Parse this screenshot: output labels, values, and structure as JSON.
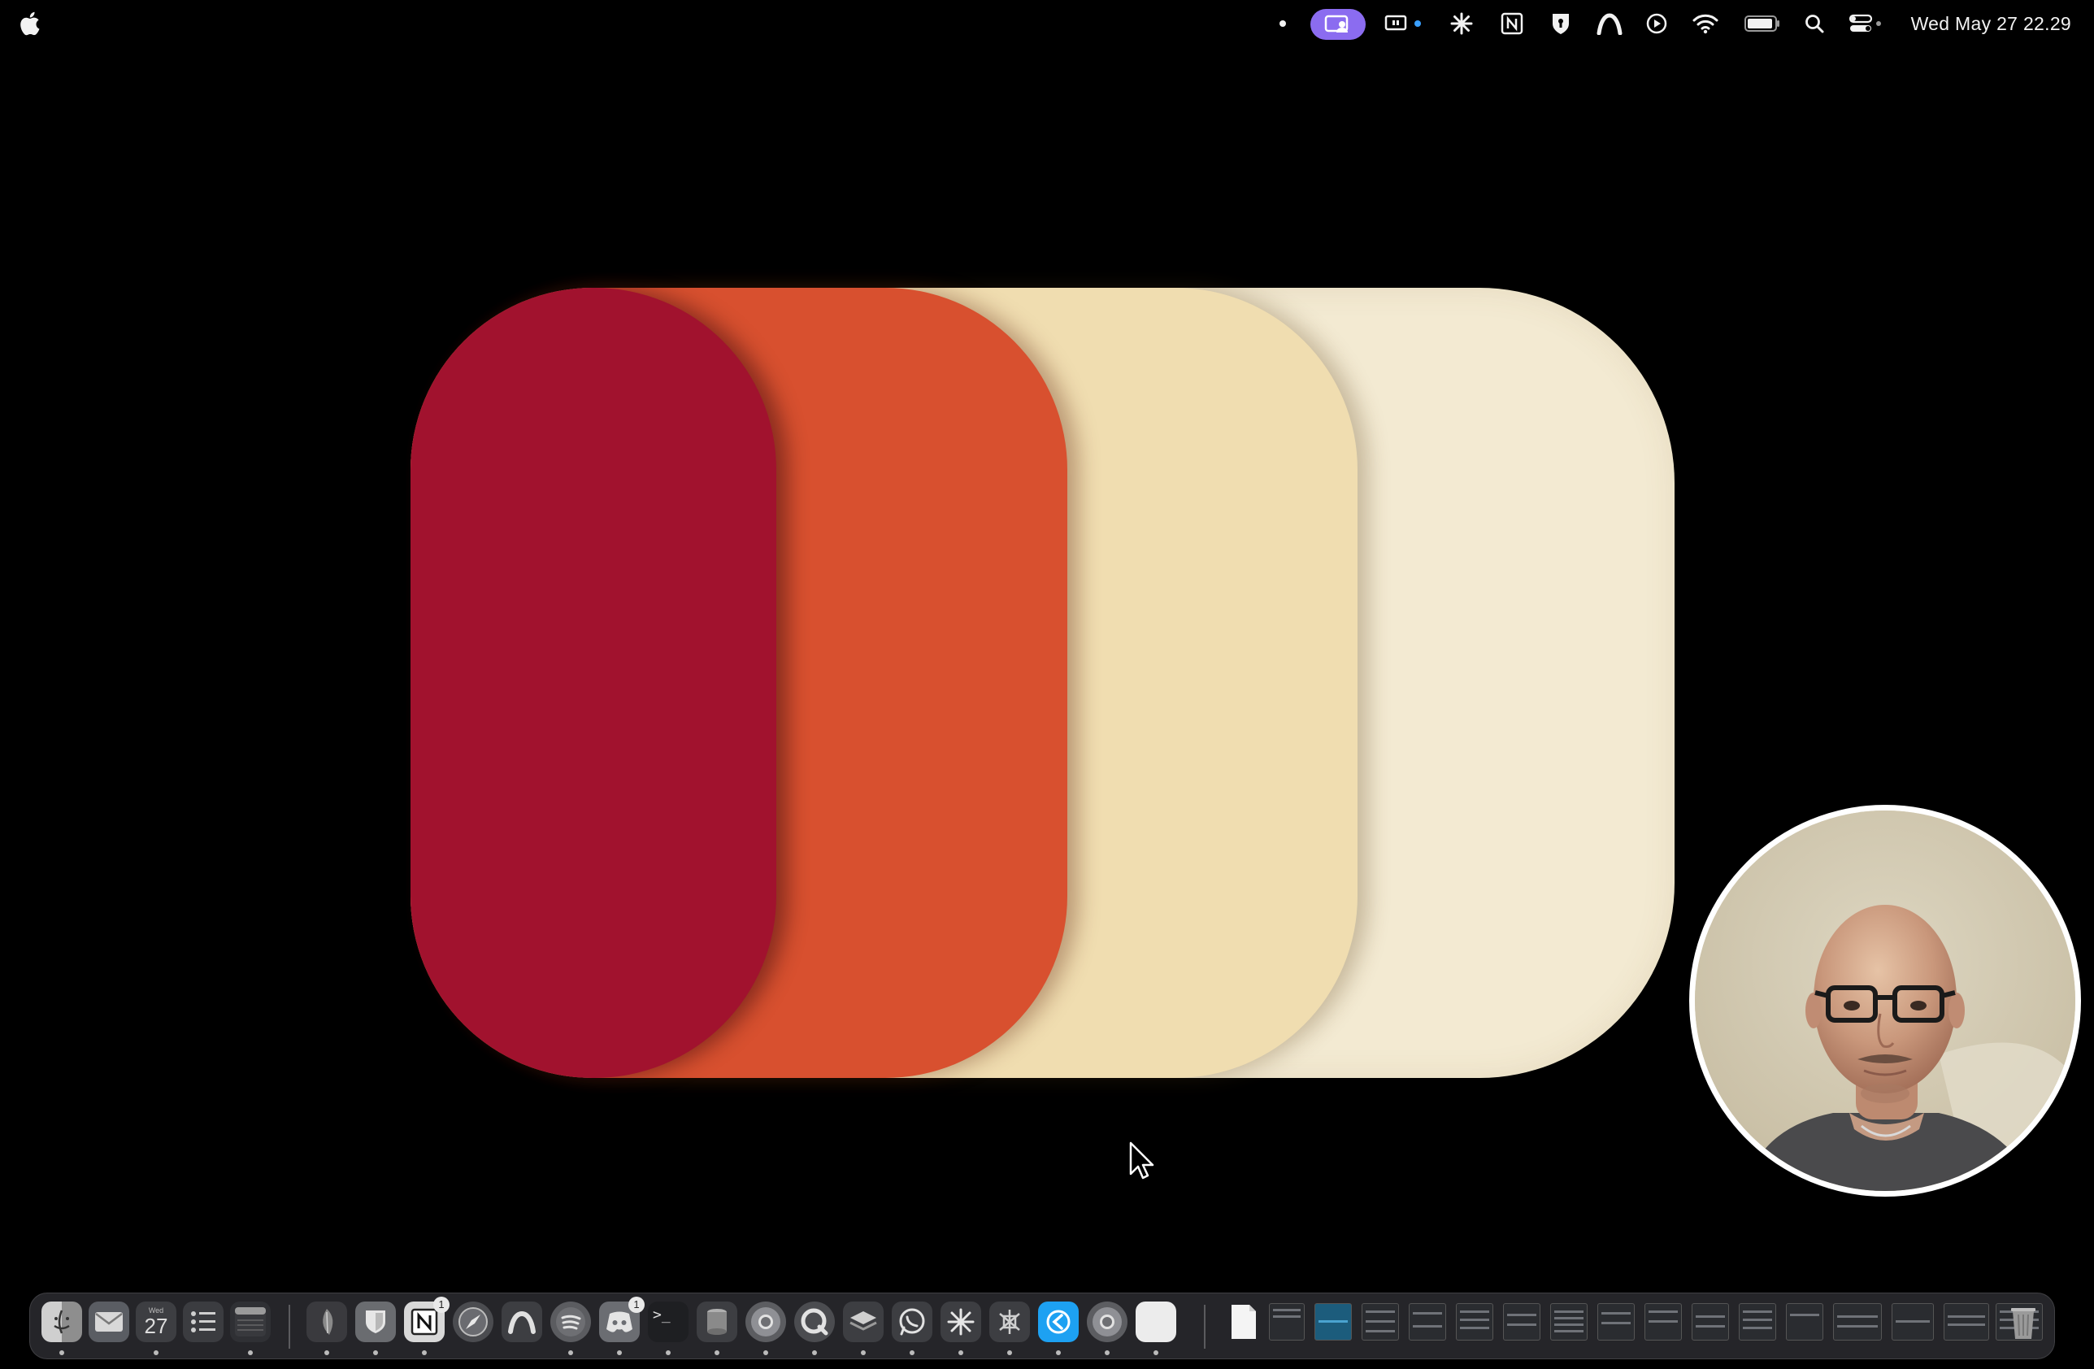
{
  "menubar": {
    "clock": "Wed May 27  22.29",
    "accent_color": "#8b6cf0",
    "status_icons": [
      "dot-icon",
      "screen-share-icon",
      "display-icon",
      "sparkle-icon",
      "notion-icon",
      "keyhole-icon",
      "arc-icon",
      "play-icon",
      "wifi-icon",
      "battery-icon",
      "search-icon",
      "control-center-icon"
    ]
  },
  "wallpaper": {
    "colors": [
      "#a1122e",
      "#d8502f",
      "#f0ddb0",
      "#f3ead2"
    ]
  },
  "dock": {
    "calendar_day_label": "Wed",
    "calendar_date": "27",
    "notion_badge": "1",
    "discord_badge": "1",
    "terminal_prompt": ">_",
    "apps": [
      "finder",
      "mail",
      "calendar",
      "reminders",
      "notes",
      "pdf",
      "bitwarden",
      "notion",
      "compass",
      "arc",
      "spotify",
      "discord",
      "terminal",
      "keychain",
      "chrome",
      "quicktime",
      "layers",
      "whatsapp",
      "perplexity",
      "spider",
      "bluesky",
      "chrome-2",
      "blank"
    ]
  }
}
